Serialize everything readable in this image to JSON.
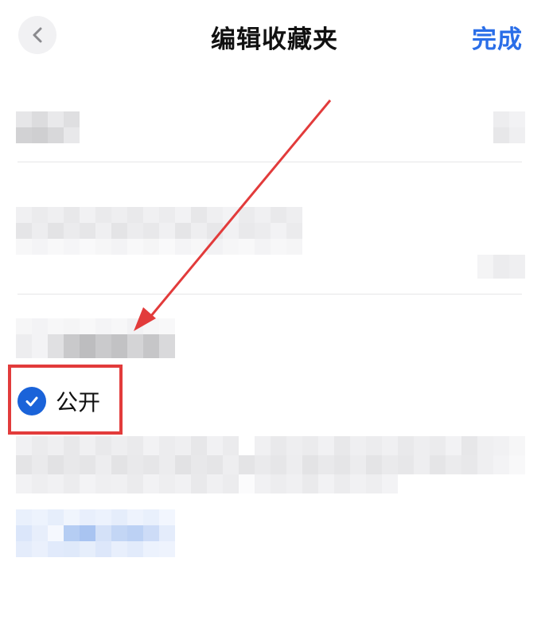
{
  "header": {
    "title": "编辑收藏夹",
    "done_label": "完成",
    "back_icon": "chevron-left-icon"
  },
  "visibility": {
    "public_label": "公开",
    "checked": true,
    "check_icon": "check-circle-icon"
  },
  "colors": {
    "accent": "#2a6ee8",
    "check": "#1a63d9",
    "annotation": "#e23b3b",
    "divider": "#e6e6e8"
  }
}
